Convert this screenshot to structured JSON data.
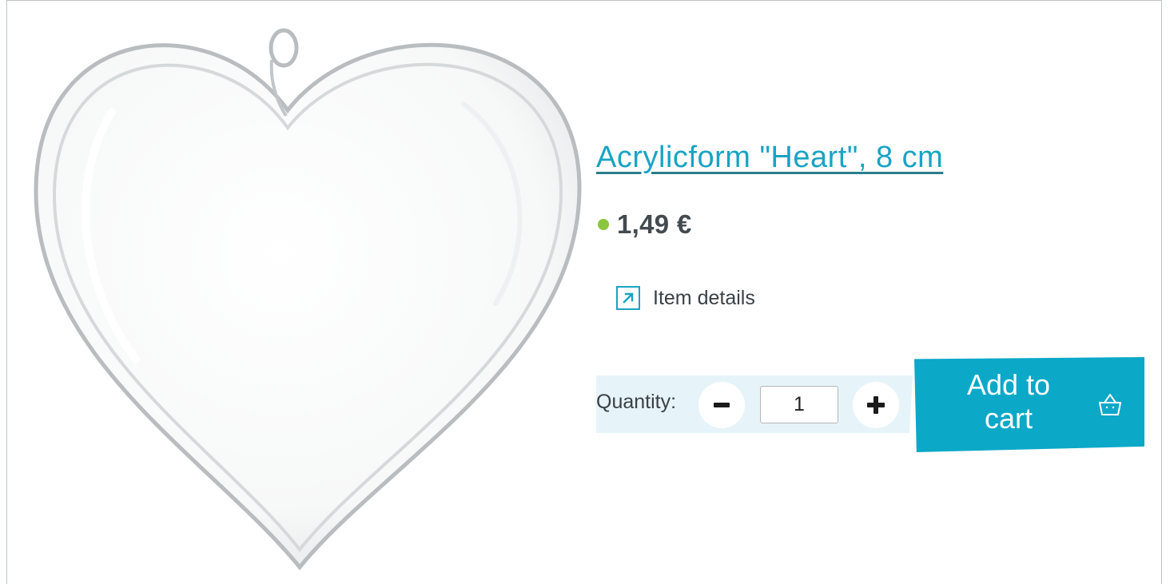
{
  "product": {
    "title": "Acrylicform \"Heart\", 8 cm",
    "price": "1,49 €",
    "availability_color": "#8cc63f",
    "image_icon": "acrylic-heart-image"
  },
  "details_link": {
    "label": "Item details",
    "icon": "external-link-icon"
  },
  "quantity": {
    "label": "Quantity:",
    "value": "1",
    "decrease_icon": "minus-icon",
    "increase_icon": "plus-icon"
  },
  "cart": {
    "label": "Add to cart",
    "icon": "basket-icon"
  },
  "colors": {
    "accent": "#1aa3c4",
    "cart_button": "#0ca8c8",
    "quantity_bar": "#e6f4f9"
  }
}
